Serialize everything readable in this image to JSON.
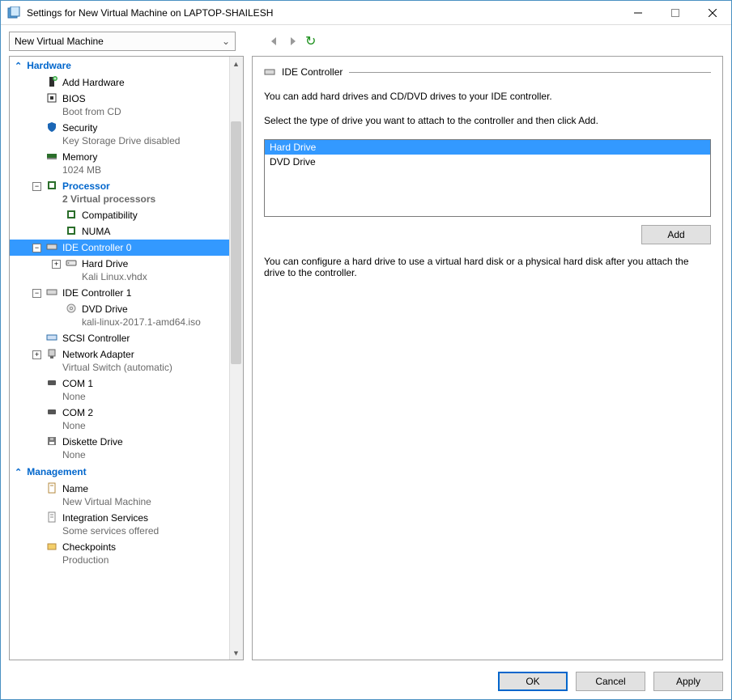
{
  "window": {
    "title": "Settings for New Virtual Machine on LAPTOP-SHAILESH"
  },
  "vm_selector": {
    "selected": "New Virtual Machine"
  },
  "tree": {
    "hardware_label": "Hardware",
    "management_label": "Management",
    "add_hw": "Add Hardware",
    "bios": {
      "label": "BIOS",
      "sub": "Boot from CD"
    },
    "security": {
      "label": "Security",
      "sub": "Key Storage Drive disabled"
    },
    "memory": {
      "label": "Memory",
      "sub": "1024 MB"
    },
    "processor": {
      "label": "Processor",
      "sub": "2 Virtual processors"
    },
    "compat": "Compatibility",
    "numa": "NUMA",
    "ide0": "IDE Controller 0",
    "ide0_hd": {
      "label": "Hard Drive",
      "sub": "Kali Linux.vhdx"
    },
    "ide1": "IDE Controller 1",
    "ide1_dvd": {
      "label": "DVD Drive",
      "sub": "kali-linux-2017.1-amd64.iso"
    },
    "scsi": "SCSI Controller",
    "netadapter": {
      "label": "Network Adapter",
      "sub": "Virtual Switch (automatic)"
    },
    "com1": {
      "label": "COM 1",
      "sub": "None"
    },
    "com2": {
      "label": "COM 2",
      "sub": "None"
    },
    "diskette": {
      "label": "Diskette Drive",
      "sub": "None"
    },
    "name": {
      "label": "Name",
      "sub": "New Virtual Machine"
    },
    "integ": {
      "label": "Integration Services",
      "sub": "Some services offered"
    },
    "checkpoints": {
      "label": "Checkpoints",
      "sub": "Production"
    }
  },
  "detail": {
    "heading": "IDE Controller",
    "p1": "You can add hard drives and CD/DVD drives to your IDE controller.",
    "p2": "Select the type of drive you want to attach to the controller and then click Add.",
    "options": {
      "hd": "Hard Drive",
      "dvd": "DVD Drive"
    },
    "add_btn": "Add",
    "note": "You can configure a hard drive to use a virtual hard disk or a physical hard disk after you attach the drive to the controller."
  },
  "footer": {
    "ok": "OK",
    "cancel": "Cancel",
    "apply": "Apply"
  }
}
